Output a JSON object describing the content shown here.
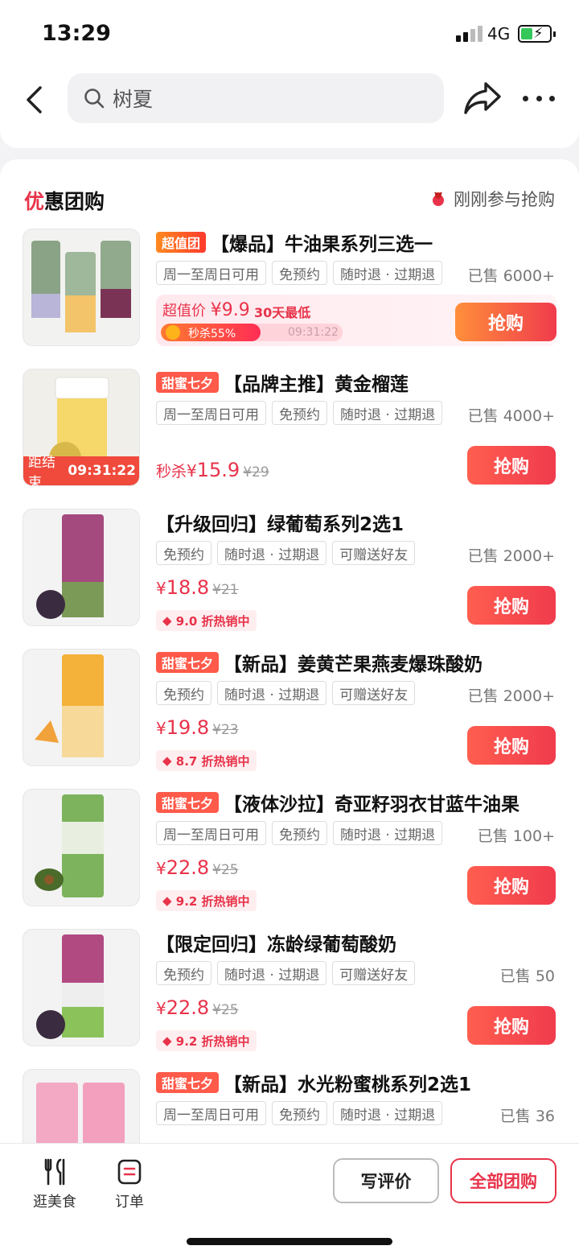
{
  "status": {
    "time": "13:29",
    "network": "4G"
  },
  "search": {
    "text": "树夏"
  },
  "section": {
    "title_accent": "优",
    "title_rest": "惠团购",
    "recent_text": "刚刚参与抢购"
  },
  "items": [
    {
      "promo_tag": "超值团",
      "title": "【爆品】牛油果系列三选一",
      "tags": [
        "周一至周日可用",
        "免预约",
        "随时退 · 过期退"
      ],
      "sold": "已售 6000+",
      "flash": {
        "price_label": "超值价 ",
        "price_value": "¥9.9",
        "lowest": "30天最低",
        "progress_label": "秒杀55%",
        "progress": 0.55,
        "timer": "09:31:22"
      },
      "buy": "抢购"
    },
    {
      "promo_tag": "甜蜜七夕",
      "title": "【品牌主推】黄金榴莲",
      "tags": [
        "周一至周日可用",
        "免预约",
        "随时退 · 过期退"
      ],
      "sold": "已售 4000+",
      "countdown_label": "距结束",
      "countdown": "09:31:22",
      "price_label": "秒杀",
      "price_yen": "¥",
      "price_now": "15.9",
      "price_old": "¥29",
      "buy": "抢购"
    },
    {
      "title": "【升级回归】绿葡萄系列2选1",
      "tags": [
        "免预约",
        "随时退 · 过期退",
        "可赠送好友"
      ],
      "sold": "已售 2000+",
      "price_yen": "¥",
      "price_now": "18.8",
      "price_old": "¥21",
      "discount": "9.0 折热销中",
      "buy": "抢购"
    },
    {
      "promo_tag": "甜蜜七夕",
      "title": "【新品】姜黄芒果燕麦爆珠酸奶",
      "tags": [
        "免预约",
        "随时退 · 过期退",
        "可赠送好友"
      ],
      "sold": "已售 2000+",
      "price_yen": "¥",
      "price_now": "19.8",
      "price_old": "¥23",
      "discount": "8.7 折热销中",
      "buy": "抢购"
    },
    {
      "promo_tag": "甜蜜七夕",
      "title": "【液体沙拉】奇亚籽羽衣甘蓝牛油果",
      "tags": [
        "周一至周日可用",
        "免预约",
        "随时退 · 过期退"
      ],
      "sold": "已售 100+",
      "price_yen": "¥",
      "price_now": "22.8",
      "price_old": "¥25",
      "discount": "9.2 折热销中",
      "buy": "抢购"
    },
    {
      "title": "【限定回归】冻龄绿葡萄酸奶",
      "tags": [
        "免预约",
        "随时退 · 过期退",
        "可赠送好友"
      ],
      "sold": "已售 50",
      "price_yen": "¥",
      "price_now": "22.8",
      "price_old": "¥25",
      "discount": "9.2 折热销中",
      "buy": "抢购"
    },
    {
      "promo_tag": "甜蜜七夕",
      "title": "【新品】水光粉蜜桃系列2选1",
      "tags": [
        "周一至周日可用",
        "免预约",
        "随时退 · 过期退"
      ],
      "sold": "已售 36"
    }
  ],
  "bottom": {
    "nav_food": "逛美食",
    "nav_order": "订单",
    "review": "写评价",
    "all_deals": "全部团购"
  },
  "colors": {
    "accent": "#e8334a",
    "buy_gradient_start": "#ff5e4f",
    "buy_gradient_end": "#f03b4d"
  },
  "icons": [
    "back-icon",
    "search-icon",
    "share-icon",
    "more-icon",
    "fork-knife-icon",
    "order-icon",
    "bolt-icon",
    "fire-tag-icon"
  ]
}
